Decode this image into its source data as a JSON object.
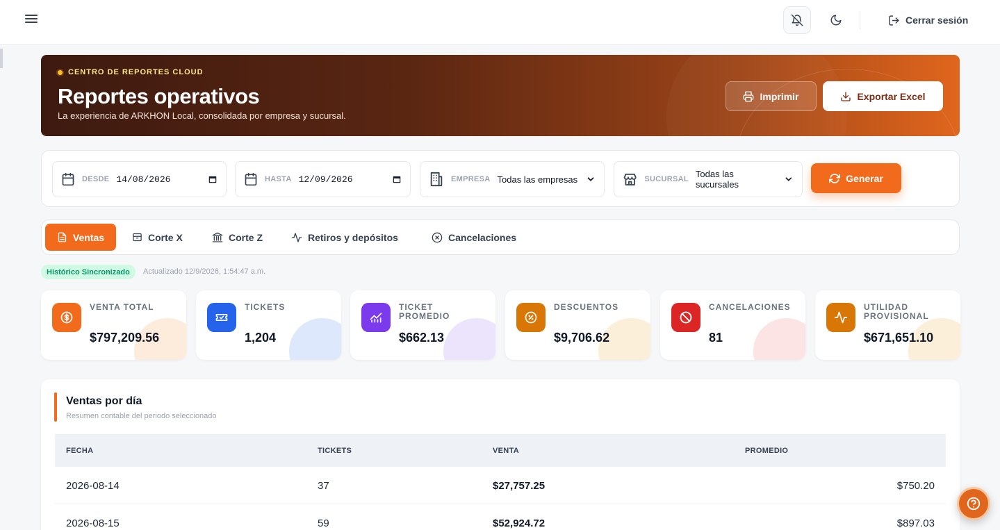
{
  "topbar": {
    "logout_label": "Cerrar sesión"
  },
  "hero": {
    "tag": "CENTRO DE REPORTES CLOUD",
    "title": "Reportes operativos",
    "subtitle": "La experiencia de ARKHON Local, consolidada por empresa y sucursal.",
    "print_label": "Imprimir",
    "export_label": "Exportar Excel"
  },
  "filters": {
    "desde_label": "DESDE",
    "desde_value": "14/08/2026",
    "hasta_label": "HASTA",
    "hasta_value": "12/09/2026",
    "empresa_label": "EMPRESA",
    "empresa_value": "Todas las empresas",
    "sucursal_label": "SUCURSAL",
    "sucursal_value": "Todas las sucursales",
    "generate_label": "Generar"
  },
  "tabs": [
    {
      "label": "Ventas",
      "icon": "document-icon"
    },
    {
      "label": "Corte X",
      "icon": "drawer-icon"
    },
    {
      "label": "Corte Z",
      "icon": "bank-icon"
    },
    {
      "label": "Retiros y depósitos",
      "icon": "pulse-icon"
    },
    {
      "label": "Cancelaciones",
      "icon": "x-circle-icon"
    }
  ],
  "status": {
    "badge": "Histórico Sincronizado",
    "updated": "Actualizado 12/9/2026, 1:54:47 a.m."
  },
  "kpis": [
    {
      "label": "VENTA TOTAL",
      "value": "$797,209.56",
      "color": "#f26a1b",
      "bubble": "#fdebdc",
      "icon": "dollar-icon"
    },
    {
      "label": "TICKETS",
      "value": "1,204",
      "color": "#2563eb",
      "bubble": "#dde8fd",
      "icon": "ticket-icon"
    },
    {
      "label": "TICKET PROMEDIO",
      "value": "$662.13",
      "color": "#7c3aed",
      "bubble": "#ece4fd",
      "icon": "chart-icon"
    },
    {
      "label": "DESCUENTOS",
      "value": "$9,706.62",
      "color": "#d97706",
      "bubble": "#fcefd9",
      "icon": "discount-icon"
    },
    {
      "label": "CANCELACIONES",
      "value": "81",
      "color": "#dc2626",
      "bubble": "#fde4e4",
      "icon": "ban-icon"
    },
    {
      "label": "UTILIDAD PROVISIONAL",
      "value": "$671,651.10",
      "color": "#d97706",
      "bubble": "#fcefd9",
      "icon": "pulse-icon"
    }
  ],
  "sales_table": {
    "title": "Ventas por día",
    "subtitle": "Resumen contable del periodo seleccionado",
    "columns": [
      "FECHA",
      "TICKETS",
      "VENTA",
      "PROMEDIO"
    ],
    "rows": [
      {
        "fecha": "2026-08-14",
        "tickets": "37",
        "venta": "$27,757.25",
        "promedio": "$750.20"
      },
      {
        "fecha": "2026-08-15",
        "tickets": "59",
        "venta": "$52,924.72",
        "promedio": "$897.03"
      }
    ]
  }
}
